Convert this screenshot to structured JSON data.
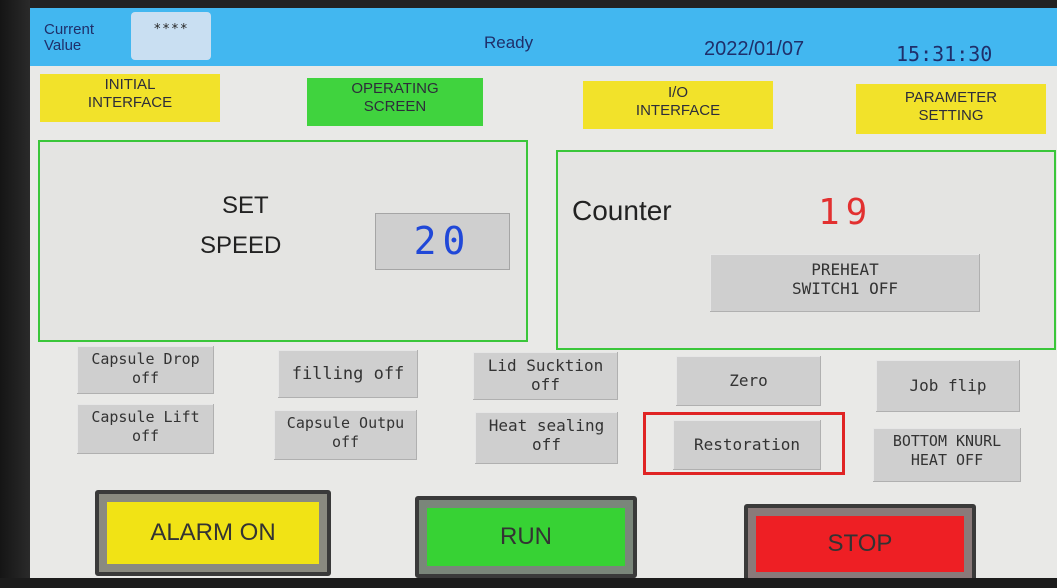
{
  "status_bar": {
    "current_value_label_1": "Current",
    "current_value_label_2": "Value",
    "current_value": "****",
    "state": "Ready",
    "date": "2022/01/07",
    "time": "15:31:30"
  },
  "nav": {
    "initial_1": "INITIAL",
    "initial_2": "INTERFACE",
    "operating_1": "OPERATING",
    "operating_2": "SCREEN",
    "io_1": "I/O",
    "io_2": "INTERFACE",
    "parameter_1": "PARAMETER",
    "parameter_2": "SETTING"
  },
  "speed_panel": {
    "label_1": "SET",
    "label_2": "SPEED",
    "value": "20"
  },
  "counter_panel": {
    "label": "Counter",
    "value": "19",
    "preheat_1": "PREHEAT",
    "preheat_2": "SWITCH1 OFF"
  },
  "controls": {
    "capsule_drop_1": "Capsule Drop",
    "capsule_drop_2": "off",
    "filling": "filling off",
    "lid_suction_1": "Lid Sucktion",
    "lid_suction_2": "off",
    "zero": "Zero",
    "job_flip": "Job flip",
    "capsule_lift_1": "Capsule Lift",
    "capsule_lift_2": "off",
    "capsule_output_1": "Capsule Outpu",
    "capsule_output_2": "off",
    "heat_sealing_1": "Heat sealing",
    "heat_sealing_2": "off",
    "restoration": "Restoration",
    "bottom_knurl_1": "BOTTOM KNURL",
    "bottom_knurl_2": "HEAT OFF"
  },
  "actions": {
    "alarm": "ALARM ON",
    "run": "RUN",
    "stop": "STOP"
  },
  "colors": {
    "status_blue": "#42b7f0",
    "nav_yellow": "#f2e22a",
    "nav_green": "#40d33e",
    "panel_border": "#3ac63a",
    "speed_value": "#2048d8",
    "counter_value": "#e23030",
    "highlight_red": "#e02424"
  }
}
